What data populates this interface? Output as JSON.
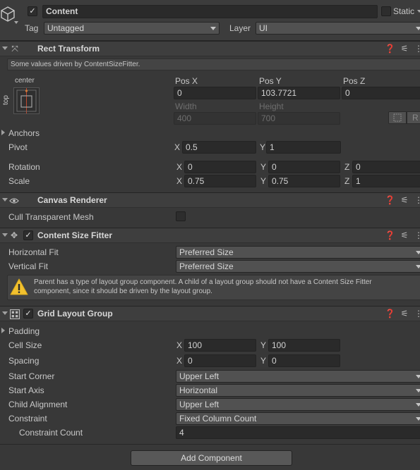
{
  "object": {
    "name": "Content",
    "static_label": "Static",
    "tag_label": "Tag",
    "tag_value": "Untagged",
    "layer_label": "Layer",
    "layer_value": "UI"
  },
  "rect_transform": {
    "title": "Rect Transform",
    "info": "Some values driven by ContentSizeFitter.",
    "anchor_h": "center",
    "anchor_v": "top",
    "pos_x_label": "Pos X",
    "pos_x": "0",
    "pos_y_label": "Pos Y",
    "pos_y": "103.7721",
    "pos_z_label": "Pos Z",
    "pos_z": "0",
    "width_label": "Width",
    "width": "400",
    "height_label": "Height",
    "height": "700",
    "r_label": "R",
    "anchors_label": "Anchors",
    "pivot_label": "Pivot",
    "pivot_x": "0.5",
    "pivot_y": "1",
    "rotation_label": "Rotation",
    "rot_x": "0",
    "rot_y": "0",
    "rot_z": "0",
    "scale_label": "Scale",
    "scale_x": "0.75",
    "scale_y": "0.75",
    "scale_z": "1",
    "axis_x": "X",
    "axis_y": "Y",
    "axis_z": "Z"
  },
  "canvas_renderer": {
    "title": "Canvas Renderer",
    "cull_label": "Cull Transparent Mesh"
  },
  "content_size_fitter": {
    "title": "Content Size Fitter",
    "hfit_label": "Horizontal Fit",
    "hfit_value": "Preferred Size",
    "vfit_label": "Vertical Fit",
    "vfit_value": "Preferred Size",
    "warning_line1": "Parent has a type of layout group component. A child of a layout group should not have a Content Size Fitter",
    "warning_line2": "component, since it should be driven by the layout group."
  },
  "grid_layout_group": {
    "title": "Grid Layout Group",
    "padding_label": "Padding",
    "cell_size_label": "Cell Size",
    "cell_x": "100",
    "cell_y": "100",
    "spacing_label": "Spacing",
    "spacing_x": "0",
    "spacing_y": "0",
    "start_corner_label": "Start Corner",
    "start_corner_value": "Upper Left",
    "start_axis_label": "Start Axis",
    "start_axis_value": "Horizontal",
    "child_alignment_label": "Child Alignment",
    "child_alignment_value": "Upper Left",
    "constraint_label": "Constraint",
    "constraint_value": "Fixed Column Count",
    "constraint_count_label": "Constraint Count",
    "constraint_count_value": "4"
  },
  "add_component_label": "Add Component"
}
